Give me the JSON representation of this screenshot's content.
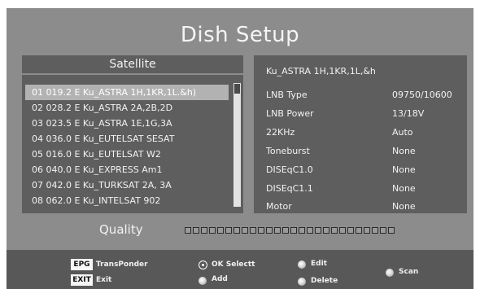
{
  "screen": {
    "title": "Dish Setup"
  },
  "satellite_panel": {
    "header": "Satellite",
    "selected_index": 0,
    "items": [
      {
        "label": "01 019.2 E Ku_ASTRA 1H,1KR,1L.&h)"
      },
      {
        "label": "02 028.2 E Ku_ASTRA 2A,2B,2D"
      },
      {
        "label": "03 023.5 E Ku_ASTRA 1E,1G,3A"
      },
      {
        "label": "04 036.0 E Ku_EUTELSAT SESAT"
      },
      {
        "label": "05 016.0 E Ku_EUTELSAT W2"
      },
      {
        "label": "06 040.0 E Ku_EXPRESS Am1"
      },
      {
        "label": "07 042.0 E Ku_TURKSAT 2A, 3A"
      },
      {
        "label": "08 062.0 E Ku_INTELSAT 902"
      }
    ]
  },
  "detail_panel": {
    "title": "Ku_ASTRA 1H,1KR,1L,&h",
    "rows": [
      {
        "label": "LNB Type",
        "value": "09750/10600"
      },
      {
        "label": "LNB Power",
        "value": "13/18V"
      },
      {
        "label": "22KHz",
        "value": "Auto"
      },
      {
        "label": "Toneburst",
        "value": "None"
      },
      {
        "label": "DISEqC1.0",
        "value": "None"
      },
      {
        "label": "DISEqC1.1",
        "value": "None"
      },
      {
        "label": "Motor",
        "value": "None"
      }
    ]
  },
  "quality": {
    "label": "Quality",
    "segments_total": 26,
    "segments_filled": 0
  },
  "footer": {
    "epg_key": "EPG",
    "epg_label": "TransPonder",
    "exit_key": "EXIT",
    "exit_label": "Exit",
    "ok_label": "OK Selectt",
    "add_label": "Add",
    "edit_label": "Edit",
    "delete_label": "Delete",
    "scan_label": "Scan"
  },
  "colors": {
    "background": "#8c8c8c",
    "panel": "#5e5e5e",
    "selected_row": "#b2b2b2",
    "footer": "#585858"
  }
}
